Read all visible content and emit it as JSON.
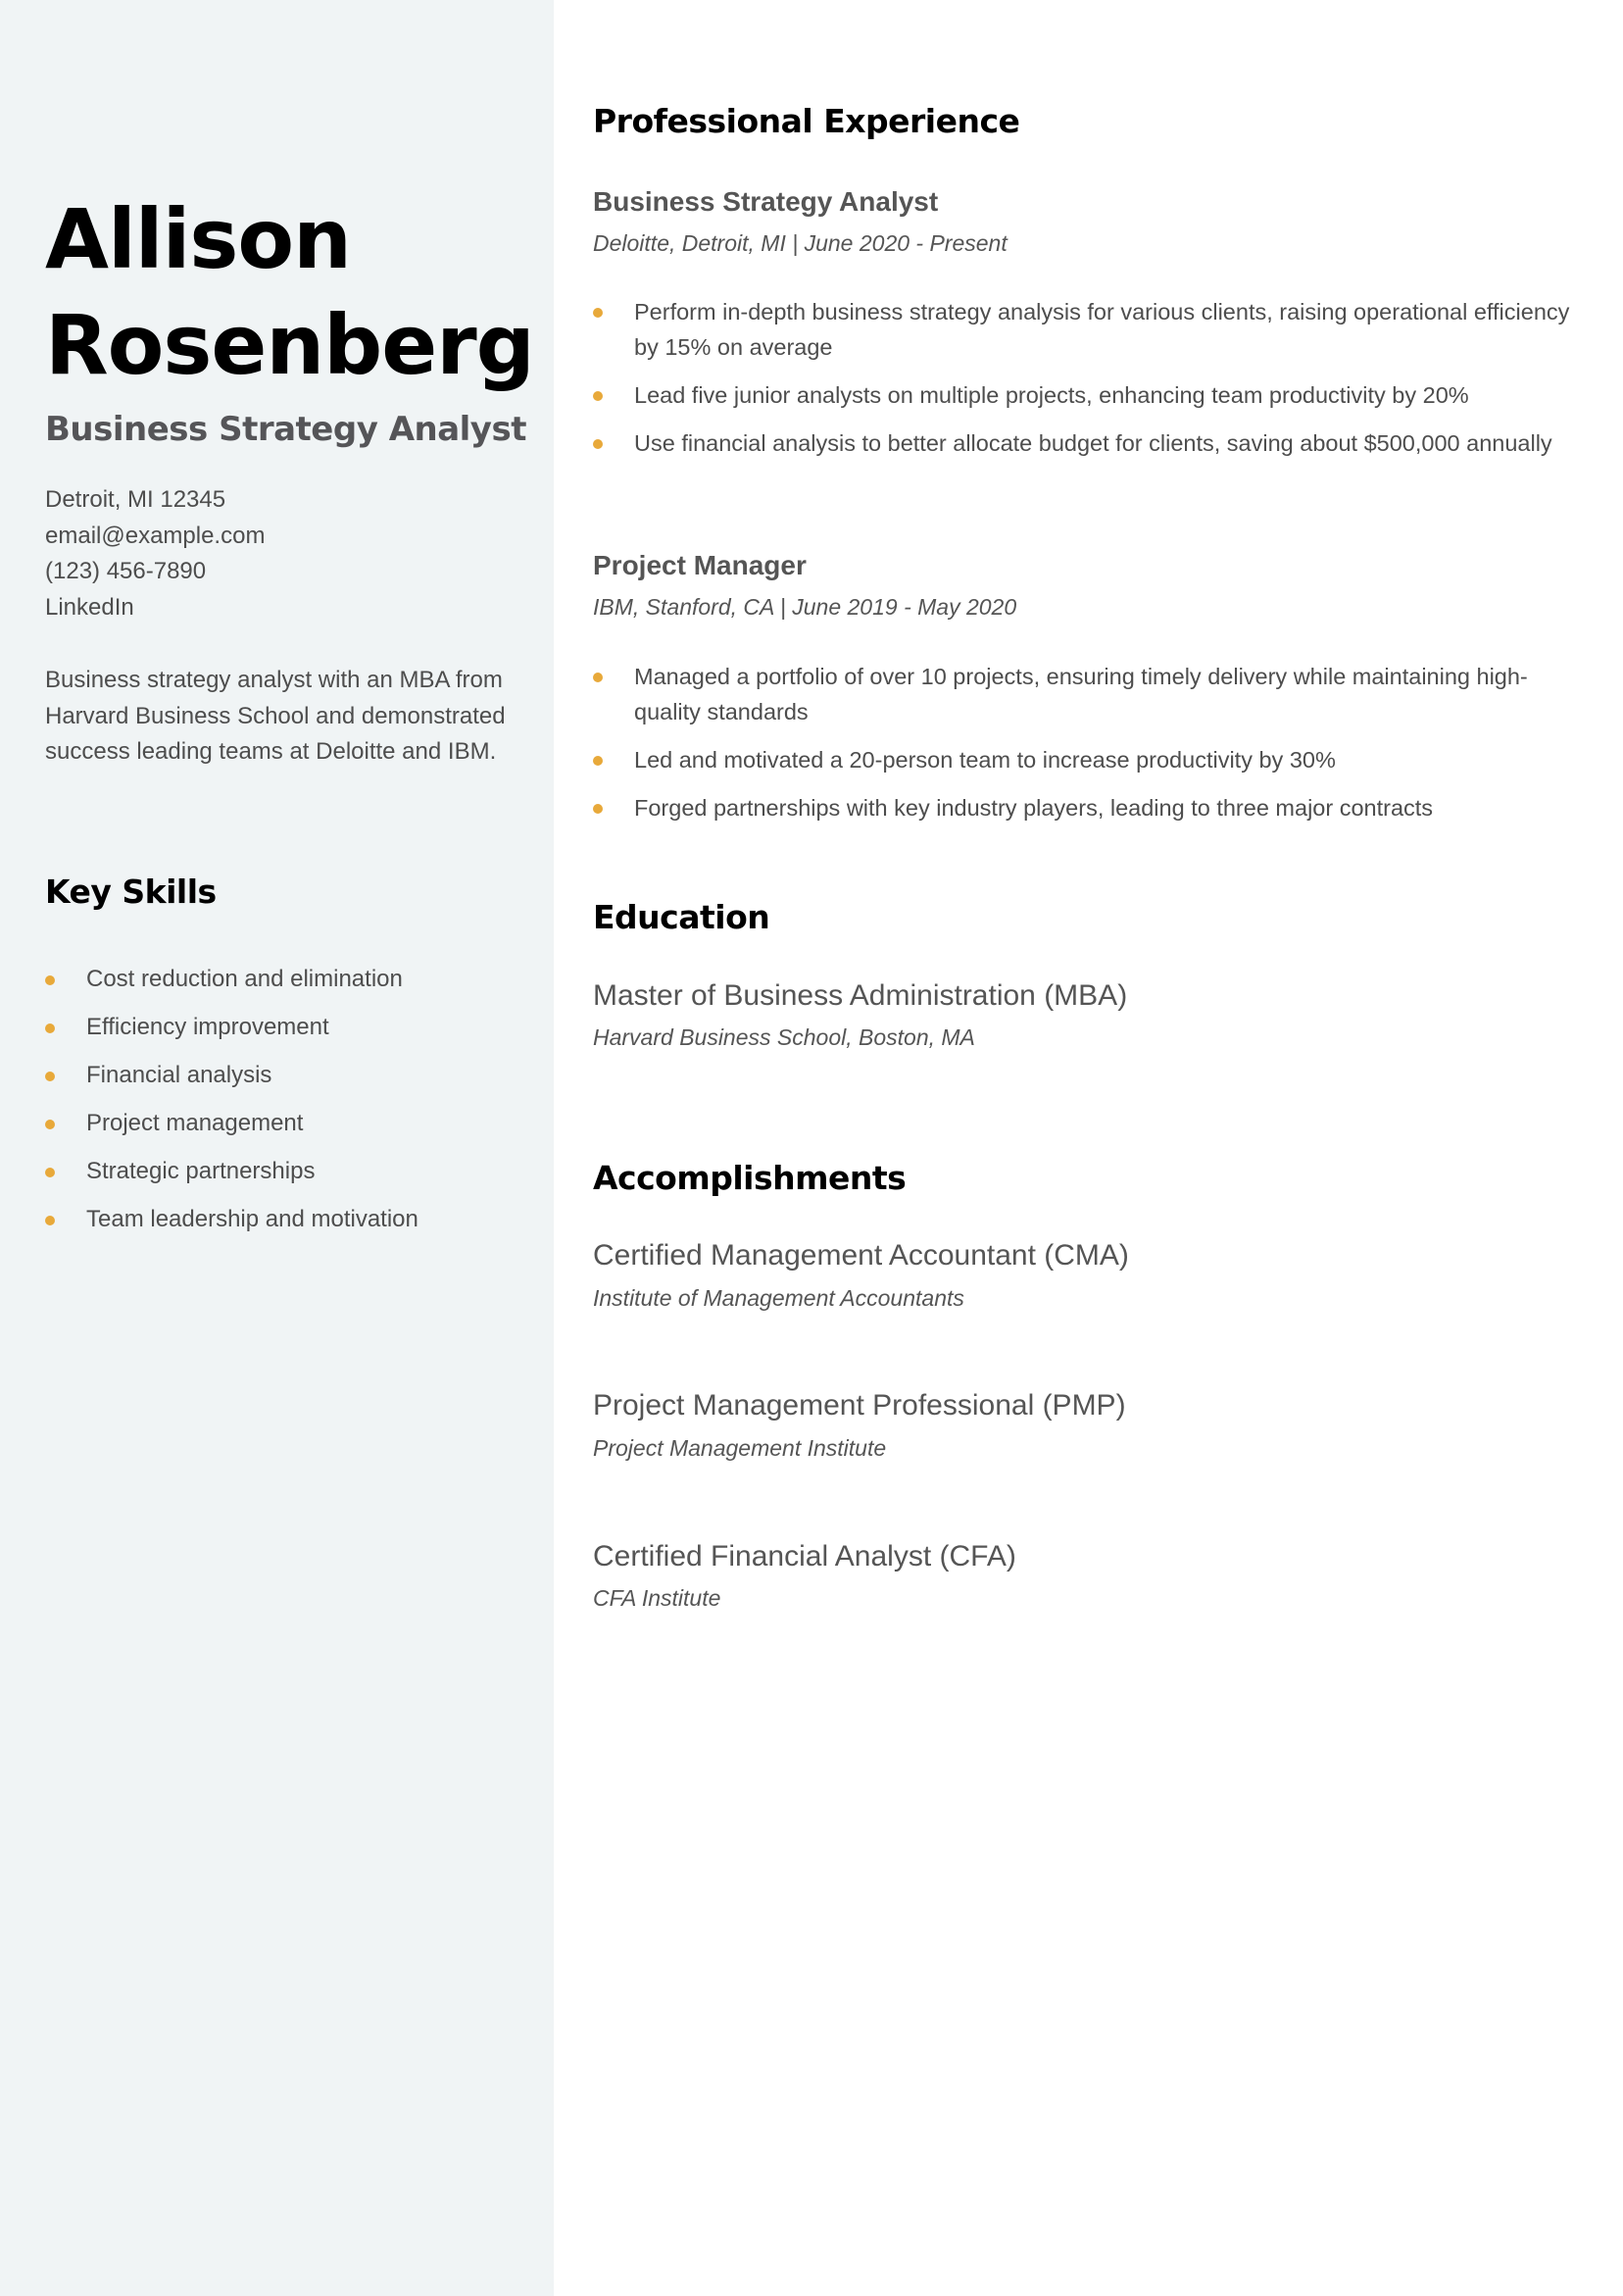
{
  "sidebar": {
    "name_line1": "Allison",
    "name_line2": "Rosenberg",
    "title": "Business Strategy Analyst",
    "contact": {
      "address": "Detroit, MI 12345",
      "email": "email@example.com",
      "phone": "(123) 456-7890",
      "linkedin": "LinkedIn"
    },
    "summary": "Business strategy analyst with an MBA from Harvard Business School and demonstrated success leading teams at Deloitte and IBM.",
    "skills_heading": "Key Skills",
    "skills": [
      "Cost reduction and elimination",
      "Efficiency improvement",
      "Financial analysis",
      "Project management",
      "Strategic partnerships",
      "Team leadership and motivation"
    ]
  },
  "experience": {
    "heading": "Professional Experience",
    "jobs": [
      {
        "title": "Business Strategy Analyst",
        "meta": "Deloitte, Detroit, MI | June 2020 - Present",
        "bullets": [
          "Perform in-depth business strategy analysis for various clients, raising operational efficiency by 15% on average",
          "Lead five junior analysts on multiple projects, enhancing team productivity by 20%",
          "Use financial analysis to better allocate budget for clients, saving about $500,000 annually"
        ]
      },
      {
        "title": "Project Manager",
        "meta": "IBM, Stanford, CA | June 2019 - May 2020",
        "bullets": [
          "Managed a portfolio of over 10 projects, ensuring timely delivery while maintaining high-quality standards",
          "Led and motivated a 20-person team to increase productivity by 30%",
          "Forged partnerships with key industry players, leading to three major contracts"
        ]
      }
    ]
  },
  "education": {
    "heading": "Education",
    "degree": "Master of Business Administration (MBA)",
    "school": "Harvard Business School, Boston, MA"
  },
  "accomplishments": {
    "heading": "Accomplishments",
    "items": [
      {
        "title": "Certified Management Accountant (CMA)",
        "issuer": "Institute of Management Accountants"
      },
      {
        "title": "Project Management Professional (PMP)",
        "issuer": "Project Management Institute"
      },
      {
        "title": "Certified Financial Analyst (CFA)",
        "issuer": "CFA Institute"
      }
    ]
  },
  "colors": {
    "sidebar_bg": "#f0f4f5",
    "bullet_accent": "#e8a93a",
    "heading": "#000000",
    "body_text": "#4d4d4d"
  }
}
